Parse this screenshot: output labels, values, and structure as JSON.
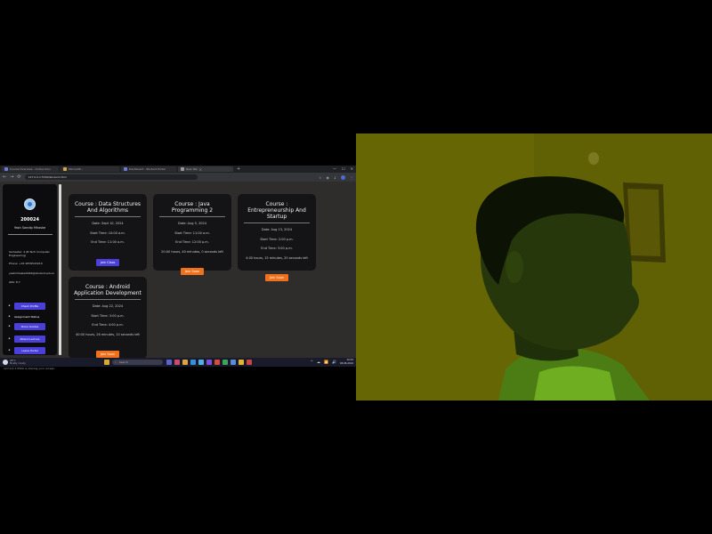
{
  "browser": {
    "tabs": [
      "Course Overview - Online Univ",
      "Microsoft...",
      "Dashboard - Student Portal",
      "New Tab"
    ],
    "new_tab_symbol": "+",
    "window_controls": [
      "—",
      "☐",
      "✕"
    ],
    "nav_symbols": [
      "←",
      "→",
      "⟳"
    ],
    "url": "127.0.0.1:5500/student.html"
  },
  "sidebar": {
    "student_id": "200024",
    "student_name": "Yash Sandip Mhaske",
    "info_lines": [
      "Semester: 4 (B.Tech Computer Engineering)",
      "Phone: +91 9876543210",
      "yashmhaske0024@student.edu.in",
      "GPA: 8.7"
    ],
    "buttons": [
      "Check Profile",
      "Assignment Status",
      "Show Grades",
      "Attend Lecture",
      "Leave Portal"
    ]
  },
  "courses": [
    {
      "title": "Course : Data Structures And Algorithms",
      "fields": [
        "Date: Sept 10, 2024",
        "Start Time: 10:00 a.m.",
        "End Time: 11:00 a.m."
      ],
      "button": "Join Class",
      "button_color": "#4a3fd9"
    },
    {
      "title": "Course : Java Programming 2",
      "fields": [
        "Date: Aug 5, 2024",
        "Start Time: 11:00 a.m.",
        "End Time: 12:00 p.m.",
        "20:00 hours, 40 minutes, 0 seconds left"
      ],
      "button": "Join Soon",
      "button_color": "#f0711c"
    },
    {
      "title": "Course : Entrepreneurship And Startup",
      "fields": [
        "Date: Aug 13, 2024",
        "Start Time: 2:00 p.m.",
        "End Time: 3:00 p.m.",
        "4:00 hours, 15 minutes, 20 seconds left"
      ],
      "button": "Join Soon",
      "button_color": "#f0711c"
    },
    {
      "title": "Course : Android Application Development",
      "fields": [
        "Date: Aug 22, 2024",
        "Start Time: 3:00 p.m.",
        "End Time: 4:00 p.m.",
        "40:00 hours, 26 minutes, 10 seconds left"
      ],
      "button": "Join Soon",
      "button_color": "#f0711c"
    }
  ],
  "taskbar": {
    "weather": [
      "28°C",
      "Mostly cloudy"
    ],
    "search_placeholder": "Search",
    "tray_symbols": [
      "^",
      "☁",
      "📶",
      "🔊"
    ],
    "time": "10:43",
    "date": "08-08-2024"
  },
  "screen_share_caption": "127.0.0.1:5500 is sharing your screen.",
  "colors": {
    "accent_blue": "#4a3fd9",
    "accent_orange": "#f0711c",
    "webcam_tint": "#5f6104"
  }
}
